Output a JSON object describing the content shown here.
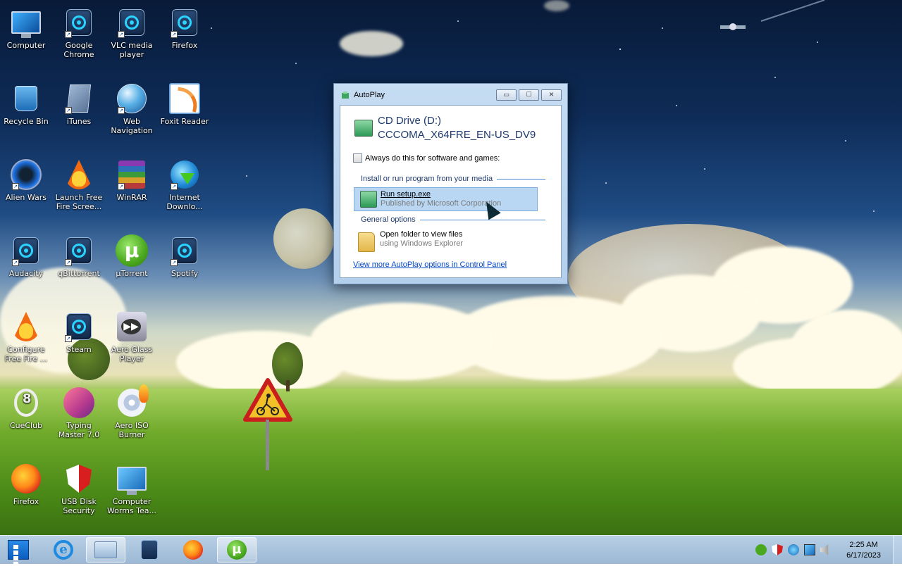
{
  "desktop_icons": [
    {
      "label": "Computer",
      "icon": "computer-icon"
    },
    {
      "label": "Google Chrome",
      "icon": "chrome-icon"
    },
    {
      "label": "VLC media player",
      "icon": "vlc-icon"
    },
    {
      "label": "Firefox",
      "icon": "firefox-icon"
    },
    {
      "label": "Recycle Bin",
      "icon": "recycle-bin-icon"
    },
    {
      "label": "iTunes",
      "icon": "itunes-icon"
    },
    {
      "label": "Web Navigation",
      "icon": "globe-icon"
    },
    {
      "label": "Foxit Reader",
      "icon": "foxit-icon"
    },
    {
      "label": "Alien Wars",
      "icon": "alien-wars-icon"
    },
    {
      "label": "Launch Free Fire Scree...",
      "icon": "fire-icon"
    },
    {
      "label": "WinRAR",
      "icon": "winrar-icon"
    },
    {
      "label": "Internet Downlo...",
      "icon": "idm-icon"
    },
    {
      "label": "Audacity",
      "icon": "audacity-icon"
    },
    {
      "label": "qBittorrent",
      "icon": "qbittorrent-icon"
    },
    {
      "label": "µTorrent",
      "icon": "utorrent-icon"
    },
    {
      "label": "Spotify",
      "icon": "spotify-icon"
    },
    {
      "label": "Configure Free Fire ...",
      "icon": "fire-icon"
    },
    {
      "label": "Steam",
      "icon": "steam-icon"
    },
    {
      "label": "Aero Glass Player",
      "icon": "aero-glass-player-icon"
    },
    {
      "label": "CueClub",
      "icon": "cueclub-icon"
    },
    {
      "label": "Typing Master 7.0",
      "icon": "typing-master-icon"
    },
    {
      "label": "Aero ISO Burner",
      "icon": "iso-burner-icon"
    },
    {
      "label": "Firefox",
      "icon": "firefox-icon"
    },
    {
      "label": "USB Disk Security",
      "icon": "shield-icon"
    },
    {
      "label": "Computer Worms Tea...",
      "icon": "computer-icon"
    }
  ],
  "dialog": {
    "title": "AutoPlay",
    "drive_name": "CD Drive (D:)",
    "drive_label": "CCCOMA_X64FRE_EN-US_DV9",
    "always_checkbox_label": "Always do this for software and games:",
    "always_checked": false,
    "section_install": "Install or run program from your media",
    "run_setup_title": "Run setup.exe",
    "run_setup_sub": "Published by Microsoft Corporation",
    "section_general": "General options",
    "open_folder_title": "Open folder to view files",
    "open_folder_sub": "using Windows Explorer",
    "more_options_link": "View more AutoPlay options in Control Panel",
    "buttons": {
      "minimize": "▭",
      "maximize": "☐",
      "close": "✕"
    }
  },
  "taskbar": {
    "apps": [
      "Internet Explorer",
      "File Explorer",
      "Media Player",
      "Firefox",
      "µTorrent"
    ],
    "utorrent_glyph": "µ",
    "ie_glyph": "e",
    "clock_time": "2:25 AM",
    "clock_date": "6/17/2023"
  }
}
